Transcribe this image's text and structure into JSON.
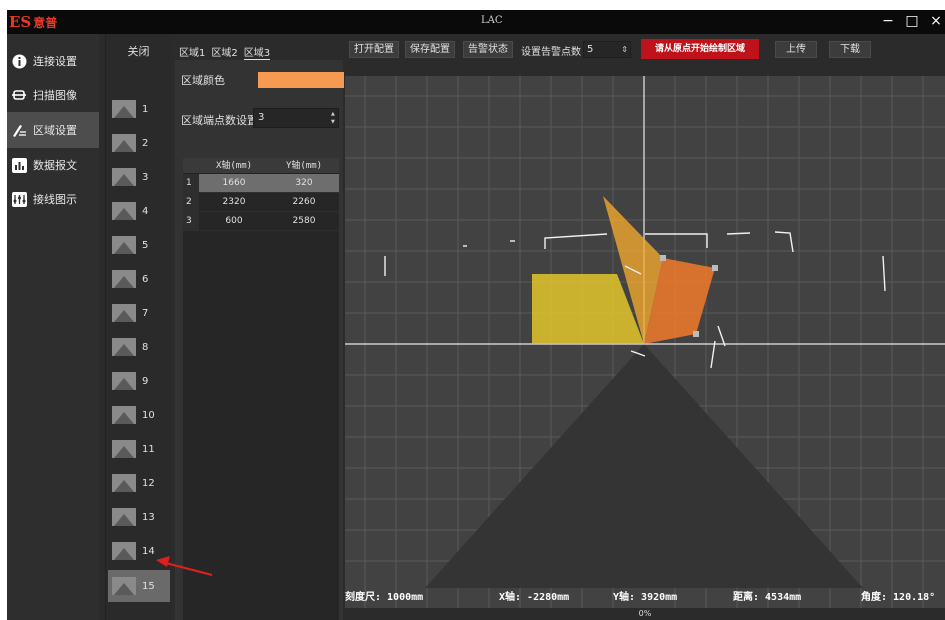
{
  "app": {
    "logo_mark": "ES",
    "logo_text": "意普",
    "title": "LAC",
    "window_controls": {
      "minimize": "−",
      "maximize": "□",
      "close": "×"
    }
  },
  "nav": {
    "items": [
      {
        "label": "连接设置",
        "icon": "info-icon"
      },
      {
        "label": "扫描图像",
        "icon": "scan-icon"
      },
      {
        "label": "区域设置",
        "icon": "region-edit-icon",
        "active": true
      },
      {
        "label": "数据报文",
        "icon": "bar-chart-icon"
      },
      {
        "label": "接线图示",
        "icon": "wiring-icon"
      }
    ]
  },
  "zones": {
    "close_label": "关闭",
    "items": [
      "1",
      "2",
      "3",
      "4",
      "5",
      "6",
      "7",
      "8",
      "9",
      "10",
      "11",
      "12",
      "13",
      "14",
      "15"
    ],
    "active": "15"
  },
  "config": {
    "tabs": [
      "区域1",
      "区域2",
      "区域3"
    ],
    "active_tab": "区域3",
    "color_label": "区域颜色",
    "color_value": "#f59a50",
    "points_label": "区域端点数设置",
    "points_value": "3",
    "table": {
      "headers": [
        "X轴(mm)",
        "Y轴(mm)"
      ],
      "rows": [
        {
          "idx": "1",
          "x": "1660",
          "y": "320"
        },
        {
          "idx": "2",
          "x": "2320",
          "y": "2260"
        },
        {
          "idx": "3",
          "x": "600",
          "y": "2580"
        }
      ]
    }
  },
  "toolbar": {
    "open_config": "打开配置",
    "save_config": "保存配置",
    "alarm_status": "告警状态",
    "alarm_points_label": "设置告警点数",
    "alarm_points_value": "5",
    "draw_prompt": "请从原点开始绘制区域",
    "upload": "上传",
    "download": "下载"
  },
  "readout": {
    "scale": "刻度尺: 1000mm",
    "x": "X轴: -2280mm",
    "y": "Y轴: 3920mm",
    "distance": "距离: 4534mm",
    "angle": "角度: 120.18°"
  },
  "status": {
    "progress": "0%"
  },
  "colors": {
    "zone1": "#e3c62a",
    "zone2": "#f0a830",
    "zone3": "#f07a2a",
    "accent_red": "#c0121a"
  }
}
